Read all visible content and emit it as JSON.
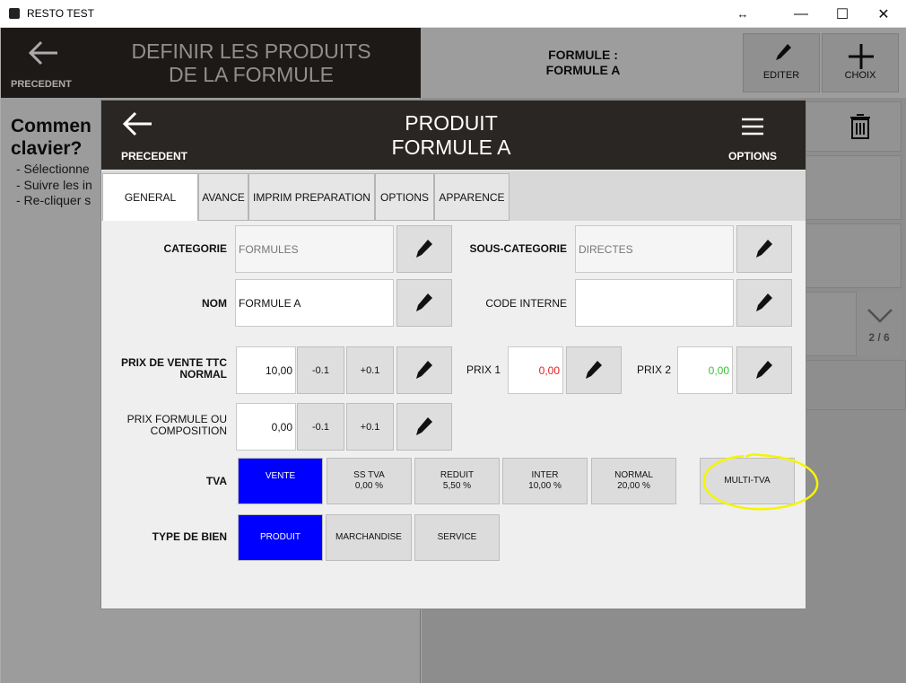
{
  "window": {
    "title": "RESTO TEST",
    "resize_glyph": "↔",
    "minimize_glyph": "—",
    "maximize_glyph": "☐",
    "close_glyph": "✕"
  },
  "background": {
    "back_label": "PRECEDENT",
    "title_line1": "DEFINIR LES PRODUITS",
    "title_line2": "DE LA FORMULE",
    "formule_line1": "FORMULE :",
    "formule_line2": "FORMULE A",
    "edit_label": "EDITER",
    "choice_label": "CHOIX",
    "help_title_line1": "Commen",
    "help_title_line2": "clavier?",
    "help_lines": [
      "- Sélectionne",
      "- Suivre les in",
      "- Re-cliquer s"
    ],
    "page_indicator": "2 / 6"
  },
  "dialog": {
    "back_label": "PRECEDENT",
    "title_line1": "PRODUIT",
    "title_line2": "FORMULE A",
    "options_label": "OPTIONS",
    "tabs": [
      "GENERAL",
      "AVANCE",
      "IMPRIM PREPARATION",
      "OPTIONS",
      "APPARENCE"
    ],
    "form": {
      "categorie_label": "CATEGORIE",
      "categorie_value": "FORMULES",
      "sous_categorie_label": "SOUS-CATEGORIE",
      "sous_categorie_value": "DIRECTES",
      "nom_label": "NOM",
      "nom_value": "FORMULE A",
      "code_interne_label": "CODE INTERNE",
      "code_interne_value": "",
      "prix_vente_line1": "PRIX DE VENTE TTC",
      "prix_vente_line2": "NORMAL",
      "prix_vente_value": "10,00",
      "minus_label": "-0.1",
      "plus_label": "+0.1",
      "prix1_label": "PRIX 1",
      "prix1_value": "0,00",
      "prix2_label": "PRIX 2",
      "prix2_value": "0,00",
      "prix_formule_line1": "PRIX FORMULE OU",
      "prix_formule_line2": "COMPOSITION",
      "prix_formule_value": "0,00",
      "tva_label": "TVA",
      "tva_options": [
        {
          "line1": "VENTE",
          "line2": ""
        },
        {
          "line1": "SS TVA",
          "line2": "0,00 %"
        },
        {
          "line1": "REDUIT",
          "line2": "5,50 %"
        },
        {
          "line1": "INTER",
          "line2": "10,00 %"
        },
        {
          "line1": "NORMAL",
          "line2": "20,00 %"
        }
      ],
      "multi_tva_label": "MULTI-TVA",
      "type_bien_label": "TYPE DE BIEN",
      "type_bien_options": [
        "PRODUIT",
        "MARCHANDISE",
        "SERVICE"
      ]
    }
  },
  "colors": {
    "selected": "#0000ff",
    "prix1": "#e02020",
    "prix2": "#3cc03c",
    "highlight": "#f5f500",
    "header": "#2a2623"
  }
}
